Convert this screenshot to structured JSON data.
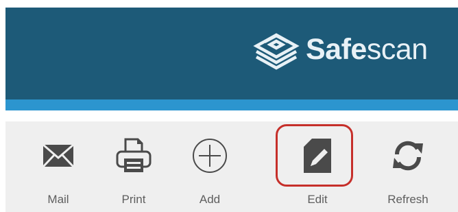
{
  "header": {
    "brand_bold": "Safe",
    "brand_regular": "scan",
    "logo_icon": "safescan-stack-icon"
  },
  "colors": {
    "header_bg": "#1d5a78",
    "accent_bar": "#2c95cf",
    "toolbar_bg": "#efefef",
    "icon": "#4a4a4a",
    "highlight": "#c62f2a"
  },
  "toolbar": {
    "items": [
      {
        "label": "Mail",
        "icon": "envelope-icon"
      },
      {
        "label": "Print",
        "icon": "printer-icon"
      },
      {
        "label": "Add",
        "icon": "plus-circle-icon"
      },
      {
        "label": "Edit",
        "icon": "edit-document-icon",
        "highlighted": true
      },
      {
        "label": "Refresh",
        "icon": "refresh-icon"
      }
    ]
  }
}
